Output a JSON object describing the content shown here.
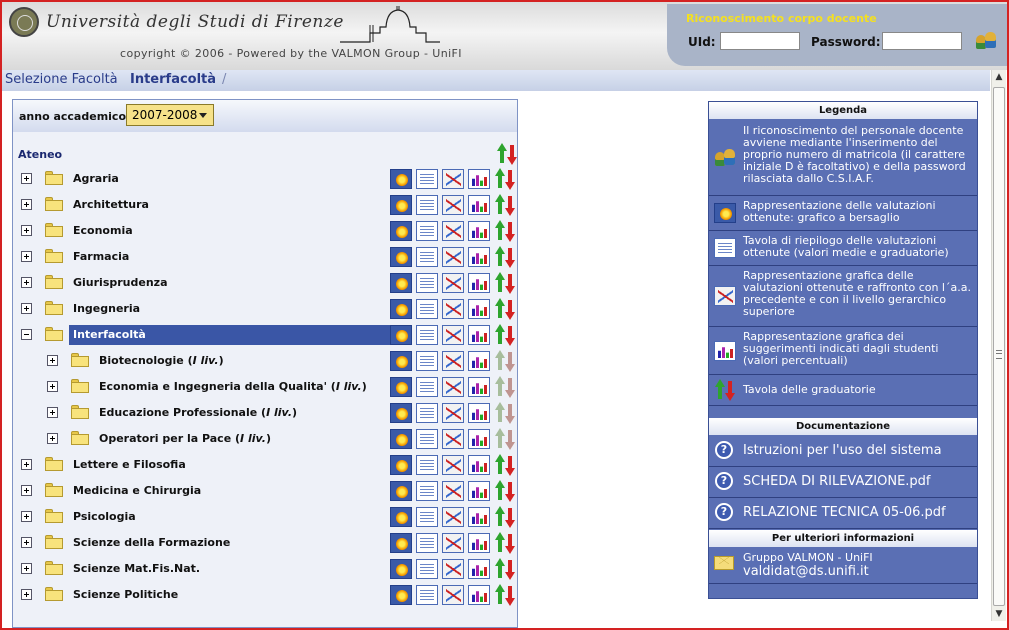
{
  "header": {
    "logo_text": "Università degli Studi di Firenze",
    "copyright": "copyright © 2006 - Powered by the VALMON Group - UniFI",
    "login": {
      "title": "Riconoscimento corpo docente",
      "uid_label": "UId:",
      "uid_value": "",
      "password_label": "Password:",
      "password_value": ""
    }
  },
  "breadcrumb": {
    "link": "Selezione Facoltà",
    "current": "Interfacoltà",
    "separator": "/"
  },
  "tree": {
    "year_label": "anno accademico:",
    "year_value": "2007-2008",
    "root_label": "Ateneo",
    "rows": [
      {
        "label": "Agraria",
        "level": 0,
        "expanded": false,
        "selected": false
      },
      {
        "label": "Architettura",
        "level": 0,
        "expanded": false,
        "selected": false
      },
      {
        "label": "Economia",
        "level": 0,
        "expanded": false,
        "selected": false
      },
      {
        "label": "Farmacia",
        "level": 0,
        "expanded": false,
        "selected": false
      },
      {
        "label": "Giurisprudenza",
        "level": 0,
        "expanded": false,
        "selected": false
      },
      {
        "label": "Ingegneria",
        "level": 0,
        "expanded": false,
        "selected": false
      },
      {
        "label": "Interfacoltà",
        "level": 0,
        "expanded": true,
        "selected": true
      },
      {
        "label": "Biotecnologie",
        "suffix": "I liv.",
        "level": 1,
        "expanded": false,
        "selected": false
      },
      {
        "label": "Economia e Ingegneria della Qualita'",
        "suffix": "I liv.",
        "level": 1,
        "expanded": false,
        "selected": false
      },
      {
        "label": "Educazione Professionale",
        "suffix": "I liv.",
        "level": 1,
        "expanded": false,
        "selected": false
      },
      {
        "label": "Operatori per la Pace",
        "suffix": "I liv.",
        "level": 1,
        "expanded": false,
        "selected": false
      },
      {
        "label": "Lettere e Filosofia",
        "level": 0,
        "expanded": false,
        "selected": false
      },
      {
        "label": "Medicina e Chirurgia",
        "level": 0,
        "expanded": false,
        "selected": false
      },
      {
        "label": "Psicologia",
        "level": 0,
        "expanded": false,
        "selected": false
      },
      {
        "label": "Scienze della Formazione",
        "level": 0,
        "expanded": false,
        "selected": false
      },
      {
        "label": "Scienze Mat.Fis.Nat.",
        "level": 0,
        "expanded": false,
        "selected": false
      },
      {
        "label": "Scienze Politiche",
        "level": 0,
        "expanded": false,
        "selected": false
      }
    ]
  },
  "legend": {
    "title": "Legenda",
    "items": [
      {
        "icon": "users-icon",
        "text": "Il riconoscimento del personale docente avviene mediante l'inserimento del proprio numero di matricola (il carattere iniziale D è facoltativo) e della password rilasciata dallo C.S.I.A.F."
      },
      {
        "icon": "target-chart-icon",
        "text": "Rappresentazione delle valutazioni ottenute: grafico a bersaglio"
      },
      {
        "icon": "summary-table-icon",
        "text": "Tavola di riepilogo delle valutazioni ottenute (valori medie e graduatorie)"
      },
      {
        "icon": "comparison-chart-icon",
        "text": "Rappresentazione grafica delle valutazioni ottenute e raffronto con l´a.a. precedente e con il livello gerarchico superiore"
      },
      {
        "icon": "bar-chart-icon",
        "text": "Rappresentazione grafica dei suggerimenti indicati dagli studenti (valori percentuali)"
      },
      {
        "icon": "ranking-arrows-icon",
        "text": "Tavola delle graduatorie"
      }
    ],
    "docs_title": "Documentazione",
    "docs": [
      {
        "text": "Istruzioni per l'uso del sistema"
      },
      {
        "text": "SCHEDA DI RILEVAZIONE.pdf"
      },
      {
        "text": "RELAZIONE TECNICA 05-06.pdf"
      }
    ],
    "info_title": "Per ulteriori informazioni",
    "contact_group": "Gruppo VALMON - UniFI",
    "contact_email": "valdidat@ds.unifi.it"
  }
}
